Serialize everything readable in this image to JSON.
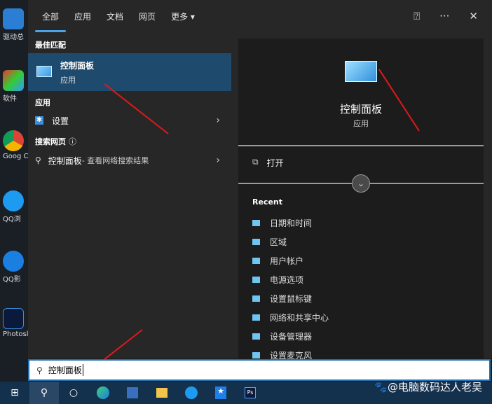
{
  "desktop": {
    "icons": [
      "驱动总",
      "软件",
      "Goog Chron",
      "QQ浏",
      "QQ影",
      "Photosl"
    ]
  },
  "tabs": [
    "全部",
    "应用",
    "文档",
    "网页",
    "更多 ▾"
  ],
  "top_icons": {
    "feedback": "feedback-icon",
    "more": "···",
    "close": "✕"
  },
  "left": {
    "best_match_title": "最佳匹配",
    "best_match": {
      "name": "控制面板",
      "type": "应用"
    },
    "apps_title": "应用",
    "apps": [
      {
        "name": "设置"
      }
    ],
    "web_title": "搜索网页",
    "web": {
      "query": "控制面板",
      "suffix": " - 查看网络搜索结果"
    }
  },
  "right": {
    "app_name": "控制面板",
    "app_type": "应用",
    "open_label": "打开",
    "recent_title": "Recent",
    "recent": [
      "日期和时间",
      "区域",
      "用户帐户",
      "电源选项",
      "设置鼠标键",
      "网络和共享中心",
      "设备管理器",
      "设置麦克风"
    ]
  },
  "search": {
    "value": "控制面板"
  },
  "watermark": "🐾@电脑数码达人老吴",
  "colors": {
    "accent": "#4aa3e8",
    "selected": "#1e4a6e",
    "taskbar": "#13304d",
    "arrow": "#e0191b"
  }
}
